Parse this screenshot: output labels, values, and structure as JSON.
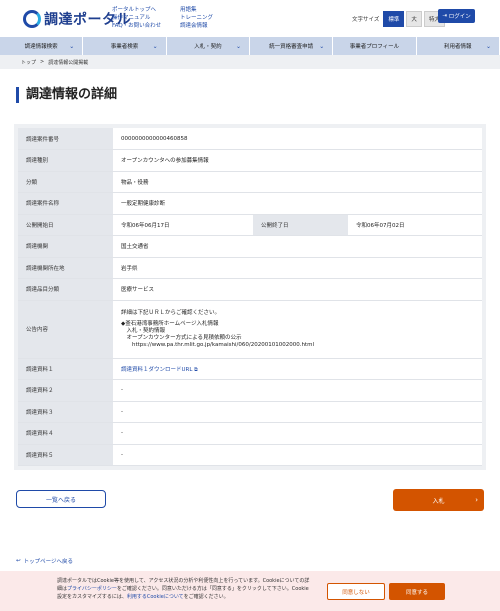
{
  "header": {
    "logo_text": "調達ポータル",
    "links_col1": [
      "ポータルトップへ",
      "操作マニュアル",
      "FAQ・お問い合わせ"
    ],
    "links_col2": [
      "用語集",
      "トレーニング",
      "調達会情報"
    ],
    "font_size_label": "文字サイズ",
    "font_sizes": [
      "標準",
      "大",
      "特大"
    ],
    "login_label": "ログイン"
  },
  "nav": [
    "調達情報検索",
    "事業者検索",
    "入札・契約",
    "統一資格審査申請",
    "事業者プロフィール",
    "利用者情報"
  ],
  "breadcrumb": {
    "home": "トップ",
    "separator": ">",
    "current": "調達情報公開掲載"
  },
  "page_title": "調達情報の詳細",
  "details": {
    "case_number_label": "調達案件番号",
    "case_number": "0000000000000460858",
    "type_label": "調達種別",
    "type": "オープンカウンタへの参加募集情報",
    "category_label": "分類",
    "category": "物品・役務",
    "name_label": "調達案件名称",
    "name": "一般定期健康診断",
    "start_label": "公開開始日",
    "start": "令和06年06月17日",
    "end_label": "公開終了日",
    "end": "令和06年07月02日",
    "agency_label": "調達機関",
    "agency": "国土交通省",
    "location_label": "調達機関所在地",
    "location": "岩手県",
    "item_category_label": "調達品目分類",
    "item_category": "医療サービス",
    "notice_label": "公告内容",
    "notice_lines": [
      "詳細は下記ＵＲＬからご確認ください。",
      "",
      "◆釜石港湾事務所ホームページ入札情報",
      "　入札・契約情報",
      "　オープンカウンター方式による見積依頼の公示",
      "　　https://www.pa.thr.mlit.go.jp/kamaishi/060/20200101002000.html"
    ],
    "doc1_label": "調達資料１",
    "doc1": "調達資料１ダウンロードURL",
    "doc2_label": "調達資料２",
    "doc2": "-",
    "doc3_label": "調達資料３",
    "doc3": "-",
    "doc4_label": "調達資料４",
    "doc4": "-",
    "doc5_label": "調達資料５",
    "doc5": "-"
  },
  "buttons": {
    "back": "一覧へ戻る",
    "bid": "入札"
  },
  "to_top": "トップページへ戻る",
  "cookie": {
    "text_1": "調達ポータルではCookie等を使用して、アクセス状況の分析や利便性向上を行っています。Cookieについての詳細は",
    "privacy_link": "プライバシーポリシー",
    "text_2": "をご確認ください。同意いただける方は「同意する」をクリックして下さい。Cookie設定をカスタマイズするには、",
    "cookie_link": "利用するCookieについて",
    "text_3": "をご確認ください。",
    "decline": "同意しない",
    "accept": "同意する"
  },
  "colors": {
    "primary": "#1f4aa8",
    "accent": "#d35400",
    "nav_bg": "#c9d5e9",
    "cookie_bg": "#fbe9e9"
  }
}
